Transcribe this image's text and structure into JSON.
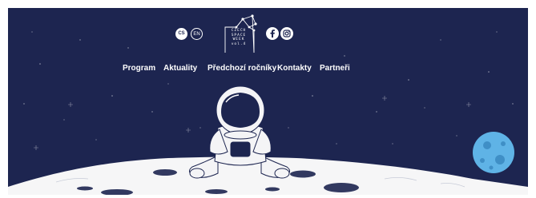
{
  "languages": {
    "cs": "CS",
    "en": "EN",
    "active": "cs"
  },
  "logo": {
    "line1": "CZECH",
    "line2": "SPACE",
    "line3": "WEEK",
    "line4": "vol.4"
  },
  "social": {
    "facebook_icon": "facebook-icon",
    "instagram_icon": "instagram-icon"
  },
  "nav": {
    "items": [
      {
        "label": "Program"
      },
      {
        "label": "Aktuality"
      },
      {
        "label": "Předchozí ročníky"
      },
      {
        "label": "Kontakty"
      },
      {
        "label": "Partneři"
      }
    ]
  },
  "colors": {
    "background": "#1d2550",
    "foreground": "#ffffff",
    "planet": "#5fb3e6"
  }
}
